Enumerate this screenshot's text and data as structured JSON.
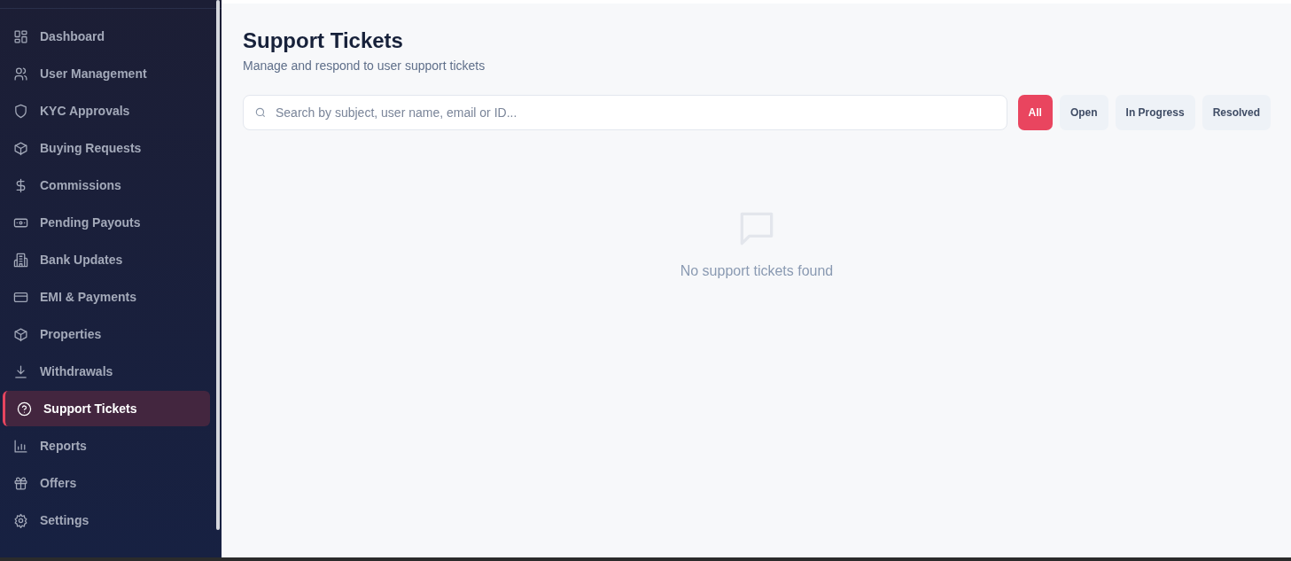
{
  "sidebar": {
    "items": [
      {
        "label": "Dashboard",
        "selected": false
      },
      {
        "label": "User Management",
        "selected": false
      },
      {
        "label": "KYC Approvals",
        "selected": false
      },
      {
        "label": "Buying Requests",
        "selected": false
      },
      {
        "label": "Commissions",
        "selected": false
      },
      {
        "label": "Pending Payouts",
        "selected": false
      },
      {
        "label": "Bank Updates",
        "selected": false
      },
      {
        "label": "EMI & Payments",
        "selected": false
      },
      {
        "label": "Properties",
        "selected": false
      },
      {
        "label": "Withdrawals",
        "selected": false
      },
      {
        "label": "Support Tickets",
        "selected": true
      },
      {
        "label": "Reports",
        "selected": false
      },
      {
        "label": "Offers",
        "selected": false
      },
      {
        "label": "Settings",
        "selected": false
      }
    ]
  },
  "page": {
    "title": "Support Tickets",
    "subtitle": "Manage and respond to user support tickets"
  },
  "search": {
    "placeholder": "Search by subject, user name, email or ID..."
  },
  "filters": [
    {
      "label": "All",
      "selected": true
    },
    {
      "label": "Open",
      "selected": false
    },
    {
      "label": "In Progress",
      "selected": false
    },
    {
      "label": "Resolved",
      "selected": false
    }
  ],
  "empty_state": {
    "message": "No support tickets found"
  }
}
